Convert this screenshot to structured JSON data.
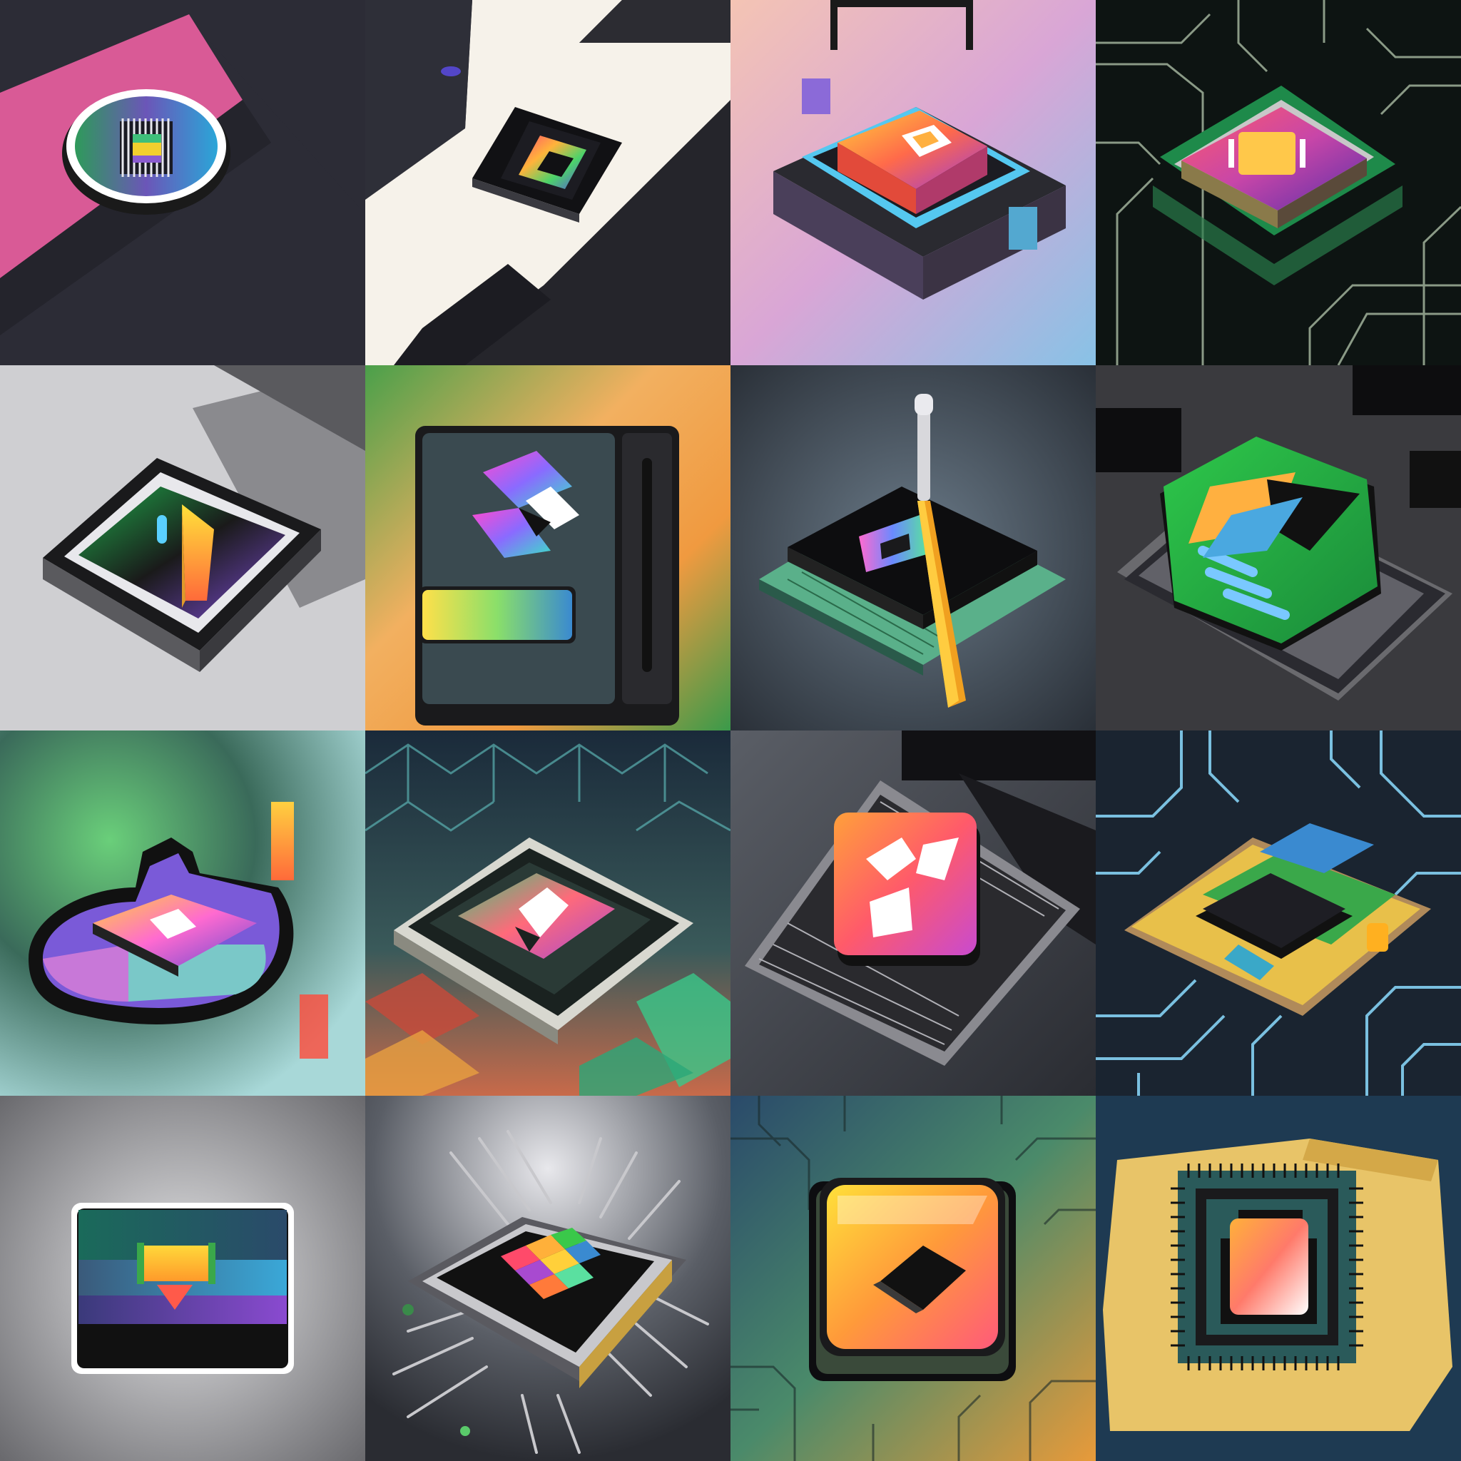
{
  "grid": {
    "rows": 4,
    "cols": 4
  },
  "tiles": [
    {
      "name": "pink-diagonal-oval-chip-icon",
      "row": 1,
      "col": 1
    },
    {
      "name": "white-path-rainbow-cpu-icon",
      "row": 1,
      "col": 2
    },
    {
      "name": "pastel-isometric-gradient-chip-icon",
      "row": 1,
      "col": 3
    },
    {
      "name": "circuit-board-pink-purple-chip-icon",
      "row": 1,
      "col": 4
    },
    {
      "name": "grey-diagonal-arrow-chip-icon",
      "row": 2,
      "col": 1
    },
    {
      "name": "orange-green-device-panel-icon",
      "row": 2,
      "col": 2
    },
    {
      "name": "black-chip-with-screwdriver-icon",
      "row": 2,
      "col": 3
    },
    {
      "name": "green-hexagon-glass-chip-icon",
      "row": 2,
      "col": 4
    },
    {
      "name": "purple-teal-blob-gradient-chip-icon",
      "row": 3,
      "col": 1
    },
    {
      "name": "geometric-cubes-green-chip-icon",
      "row": 3,
      "col": 2
    },
    {
      "name": "silver-chip-coral-square-icon",
      "row": 3,
      "col": 3
    },
    {
      "name": "blue-traces-layered-chip-icon",
      "row": 3,
      "col": 4
    },
    {
      "name": "striped-badge-shield-icon",
      "row": 4,
      "col": 1
    },
    {
      "name": "silver-chip-rainbow-grid-icon",
      "row": 4,
      "col": 2
    },
    {
      "name": "glossy-orange-chip-circuit-icon",
      "row": 4,
      "col": 3
    },
    {
      "name": "gold-paper-teal-chip-icon",
      "row": 4,
      "col": 4
    }
  ]
}
